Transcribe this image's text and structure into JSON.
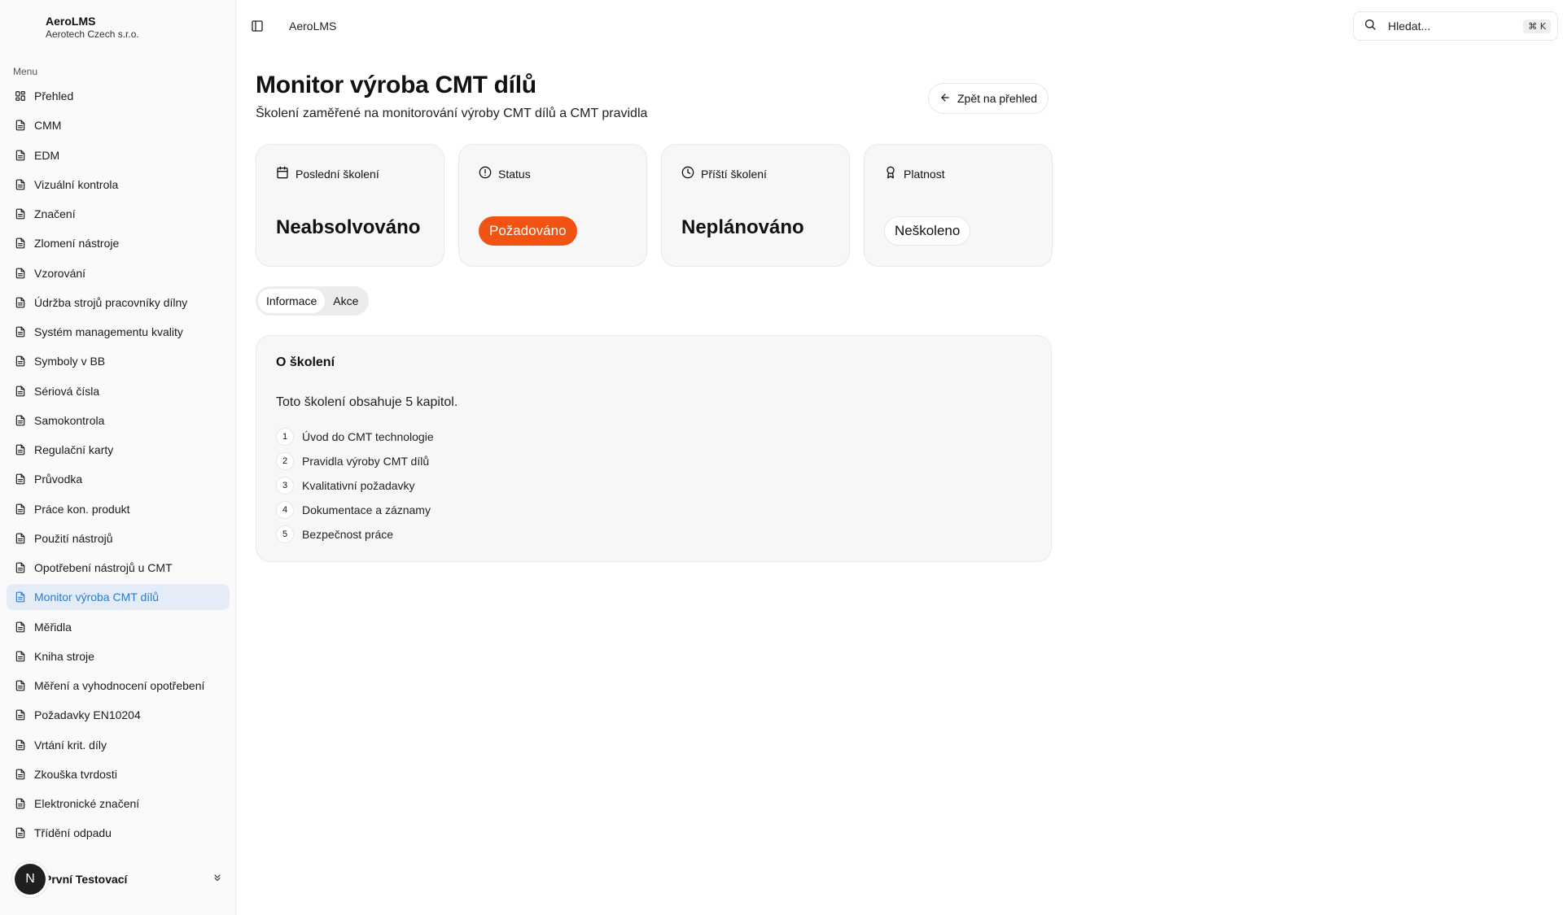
{
  "app": {
    "name": "AeroLMS",
    "organization": "Aerotech Czech s.r.o."
  },
  "sidebar": {
    "menu_label": "Menu",
    "items": [
      {
        "label": "Přehled",
        "icon": "dashboard-icon"
      },
      {
        "label": "CMM",
        "icon": "document-icon"
      },
      {
        "label": "EDM",
        "icon": "document-icon"
      },
      {
        "label": "Vizuální kontrola",
        "icon": "document-icon"
      },
      {
        "label": "Značení",
        "icon": "document-icon"
      },
      {
        "label": "Zlomení nástroje",
        "icon": "document-icon"
      },
      {
        "label": "Vzorování",
        "icon": "document-icon"
      },
      {
        "label": "Údržba strojů pracovníky dílny",
        "icon": "document-icon"
      },
      {
        "label": "Systém managementu kvality",
        "icon": "document-icon"
      },
      {
        "label": "Symboly v BB",
        "icon": "document-icon"
      },
      {
        "label": "Sériová čísla",
        "icon": "document-icon"
      },
      {
        "label": "Samokontrola",
        "icon": "document-icon"
      },
      {
        "label": "Regulační karty",
        "icon": "document-icon"
      },
      {
        "label": "Průvodka",
        "icon": "document-icon"
      },
      {
        "label": "Práce kon. produkt",
        "icon": "document-icon"
      },
      {
        "label": "Použití nástrojů",
        "icon": "document-icon"
      },
      {
        "label": "Opotřebení nástrojů u CMT",
        "icon": "document-icon"
      },
      {
        "label": "Monitor výroba CMT dílů",
        "icon": "document-icon",
        "active": true
      },
      {
        "label": "Měřidla",
        "icon": "document-icon"
      },
      {
        "label": "Kniha stroje",
        "icon": "document-icon"
      },
      {
        "label": "Měření a vyhodnocení opotřebení",
        "icon": "document-icon"
      },
      {
        "label": "Požadavky EN10204",
        "icon": "document-icon"
      },
      {
        "label": "Vrtání krit. díly",
        "icon": "document-icon"
      },
      {
        "label": "Zkouška tvrdosti",
        "icon": "document-icon"
      },
      {
        "label": "Elektronické značení",
        "icon": "document-icon"
      },
      {
        "label": "Třídění odpadu",
        "icon": "document-icon"
      }
    ],
    "user": {
      "initial": "N",
      "name": "První Testovací"
    }
  },
  "topbar": {
    "title": "AeroLMS",
    "search_placeholder": "Hledat...",
    "search_shortcut": "⌘ K"
  },
  "page": {
    "title": "Monitor výroba CMT dílů",
    "subtitle": "Školení zaměřené na monitorování výroby CMT dílů a CMT pravidla",
    "back_label": "Zpět na přehled"
  },
  "cards": [
    {
      "label": "Poslední školení",
      "value": "Neabsolvováno",
      "icon": "calendar-icon"
    },
    {
      "label": "Status",
      "value": "Požadováno",
      "icon": "alert-circle-icon"
    },
    {
      "label": "Příští školení",
      "value": "Neplánováno",
      "icon": "clock-icon"
    },
    {
      "label": "Platnost",
      "value": "Neškoleno",
      "icon": "award-icon"
    }
  ],
  "colors": {
    "status_required": "#f25212",
    "active_nav_bg": "#e3ecf7",
    "active_nav_text": "#2b7bd0"
  },
  "tabs": [
    {
      "label": "Informace",
      "active": true
    },
    {
      "label": "Akce",
      "active": false
    }
  ],
  "about": {
    "title": "O školení",
    "intro": "Toto školení obsahuje 5 kapitol.",
    "chapters": [
      {
        "number": "1",
        "title": "Úvod do CMT technologie"
      },
      {
        "number": "2",
        "title": "Pravidla výroby CMT dílů"
      },
      {
        "number": "3",
        "title": "Kvalitativní požadavky"
      },
      {
        "number": "4",
        "title": "Dokumentace a záznamy"
      },
      {
        "number": "5",
        "title": "Bezpečnost práce"
      }
    ]
  }
}
